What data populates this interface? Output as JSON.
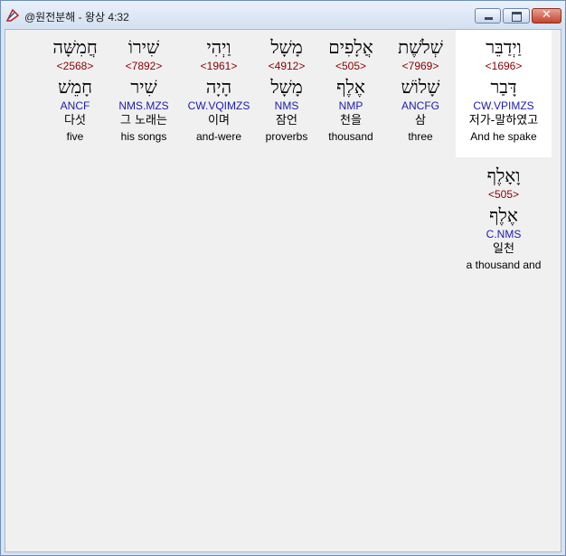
{
  "window": {
    "title": "@원전분해 - 왕상 4:32"
  },
  "columns": [
    {
      "hebrew": "חֲמִשָּׁה",
      "strong": "<2568>",
      "lemma": "חָמֵשׁ",
      "parse": "ANCF",
      "korean": "다섯",
      "english": "five"
    },
    {
      "hebrew": "שִׁירוֹ",
      "strong": "<7892>",
      "lemma": "שִׁיר",
      "parse": "NMS.MZS",
      "korean": "그 노래는",
      "english": "his songs"
    },
    {
      "hebrew": "וַיְהִי",
      "strong": "<1961>",
      "lemma": "הָיָה",
      "parse": "CW.VQIMZS",
      "korean": "이며",
      "english": "and-were"
    },
    {
      "hebrew": "מָשָׁל",
      "strong": "<4912>",
      "lemma": "מָשָׁל",
      "parse": "NMS",
      "korean": "잠언",
      "english": "proverbs"
    },
    {
      "hebrew": "אֲלָפִים",
      "strong": "<505>",
      "lemma": "אֶלֶף",
      "parse": "NMP",
      "korean": "천을",
      "english": "thousand"
    },
    {
      "hebrew": "שְׁלֹשֶׁת",
      "strong": "<7969>",
      "lemma": "שָׁלוֹשׁ",
      "parse": "ANCFG",
      "korean": "삼",
      "english": "three"
    },
    {
      "hebrew": "וַיְדַבֵּר",
      "strong": "<1696>",
      "lemma": "דָּבַר",
      "parse": "CW.VPIMZS",
      "korean": "저가-말하였고",
      "english": "And he spake"
    },
    {
      "hebrew": "וָאָלֶף",
      "strong": "<505>",
      "lemma": "אֶלֶף",
      "parse": "C.NMS",
      "korean": "일천",
      "english": "a thousand and"
    }
  ]
}
